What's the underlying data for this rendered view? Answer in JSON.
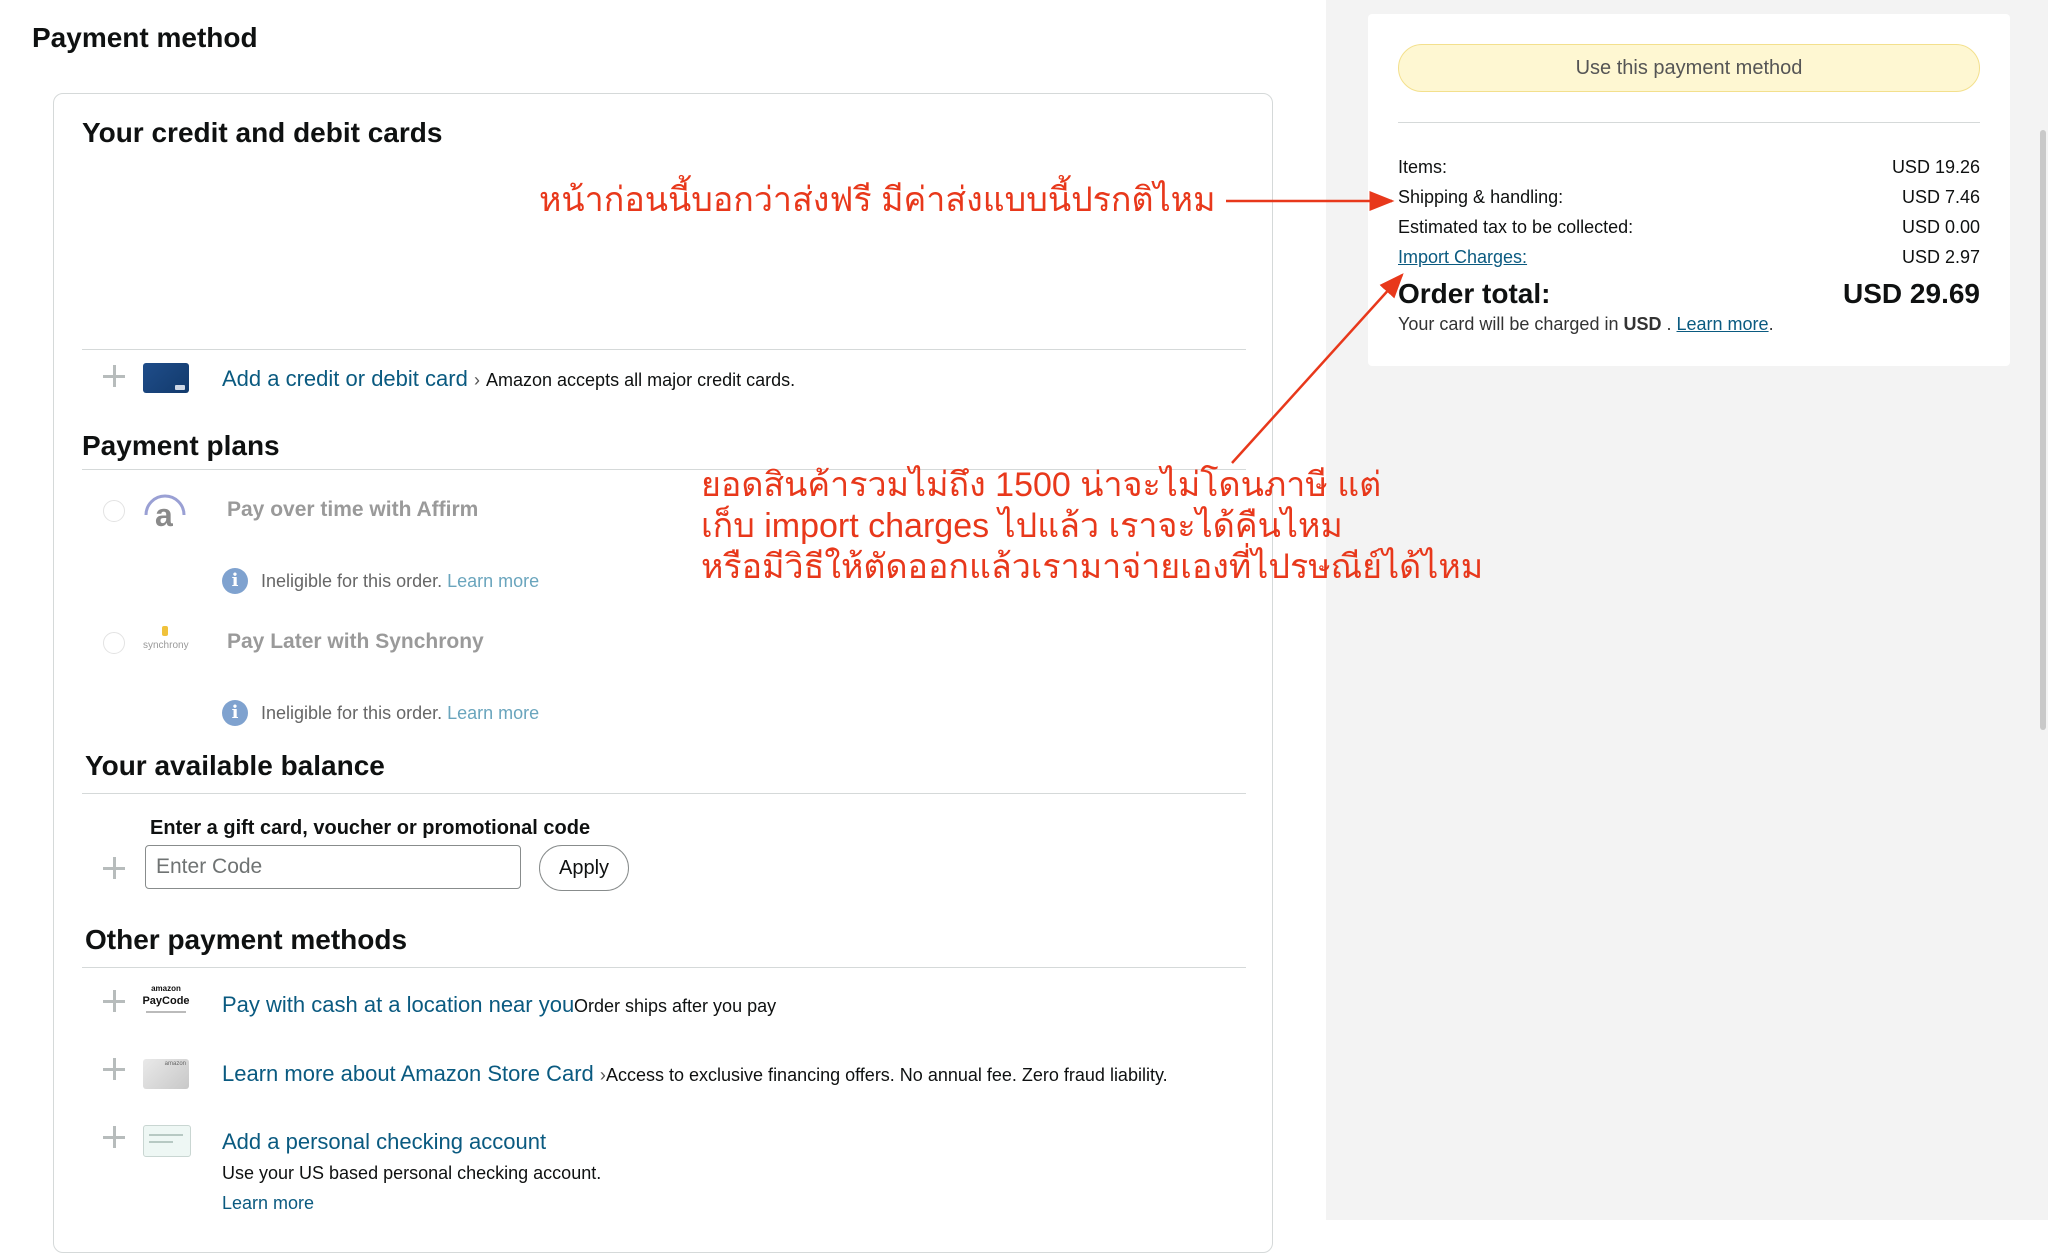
{
  "page": {
    "title": "Payment method"
  },
  "cards": {
    "title": "Your credit and debit cards",
    "add_card_label": "Add a credit or debit card",
    "chevron": "›",
    "add_card_note": "Amazon accepts all major credit cards."
  },
  "plans": {
    "title": "Payment plans",
    "affirm": {
      "label": "Pay over time with Affirm",
      "logo_text": "a",
      "ineligible": "Ineligible for this order.",
      "learn_more": "Learn more"
    },
    "synchrony": {
      "label": "Pay Later with Synchrony",
      "logo_text": "synchrony",
      "ineligible": "Ineligible for this order.",
      "learn_more": "Learn more"
    },
    "info_glyph": "i"
  },
  "balance": {
    "title": "Your available balance",
    "gift_label": "Enter a gift card, voucher or promotional code",
    "input_placeholder": "Enter Code",
    "apply_label": "Apply"
  },
  "other": {
    "title": "Other payment methods",
    "paycode": {
      "logo_top": "amazon",
      "logo_main": "PayCode",
      "label": "Pay with cash at a location near you",
      "note": "Order ships after you pay"
    },
    "store_card": {
      "logo_text": "amazon",
      "label": "Learn more about Amazon Store Card",
      "chevron": "›",
      "note": "Access to exclusive financing offers. No annual fee. Zero fraud liability."
    },
    "checking": {
      "label": "Add a personal checking account",
      "note": "Use your US based personal checking account.",
      "learn_more": "Learn more"
    }
  },
  "summary": {
    "button_label": "Use this payment method",
    "rows": [
      {
        "label": "Items:",
        "value": "USD 19.26"
      },
      {
        "label": "Shipping & handling:",
        "value": "USD 7.46"
      },
      {
        "label": "Estimated tax to be collected:",
        "value": "USD 0.00"
      },
      {
        "label": "Import Charges:",
        "value": "USD 2.97"
      }
    ],
    "total_label": "Order total:",
    "total_value": "USD 29.69",
    "charged_prefix": "Your card will be charged in",
    "currency": "USD",
    "charged_sep": " . ",
    "learn_more": "Learn more",
    "period": "."
  },
  "annotations": {
    "shipping_note": "หน้าก่อนนี้บอกว่าส่งฟรี  มีค่าส่งแบบนี้ปรกติไหม",
    "tax_note_1": "ยอดสินค้ารวมไม่ถึง 1500 น่าจะไม่โดนภาษี  แต่",
    "tax_note_2": "เก็บ import charges ไปแล้ว เราจะได้คืนไหม",
    "tax_note_3": "หรือมีวิธีให้ตัดออกแล้วเรามาจ่ายเองที่ไปรษณีย์ได้ไหม"
  },
  "colors": {
    "link": "#0a5a80",
    "annotation": "#e8381b",
    "button_yellow": "#fef7d2"
  }
}
